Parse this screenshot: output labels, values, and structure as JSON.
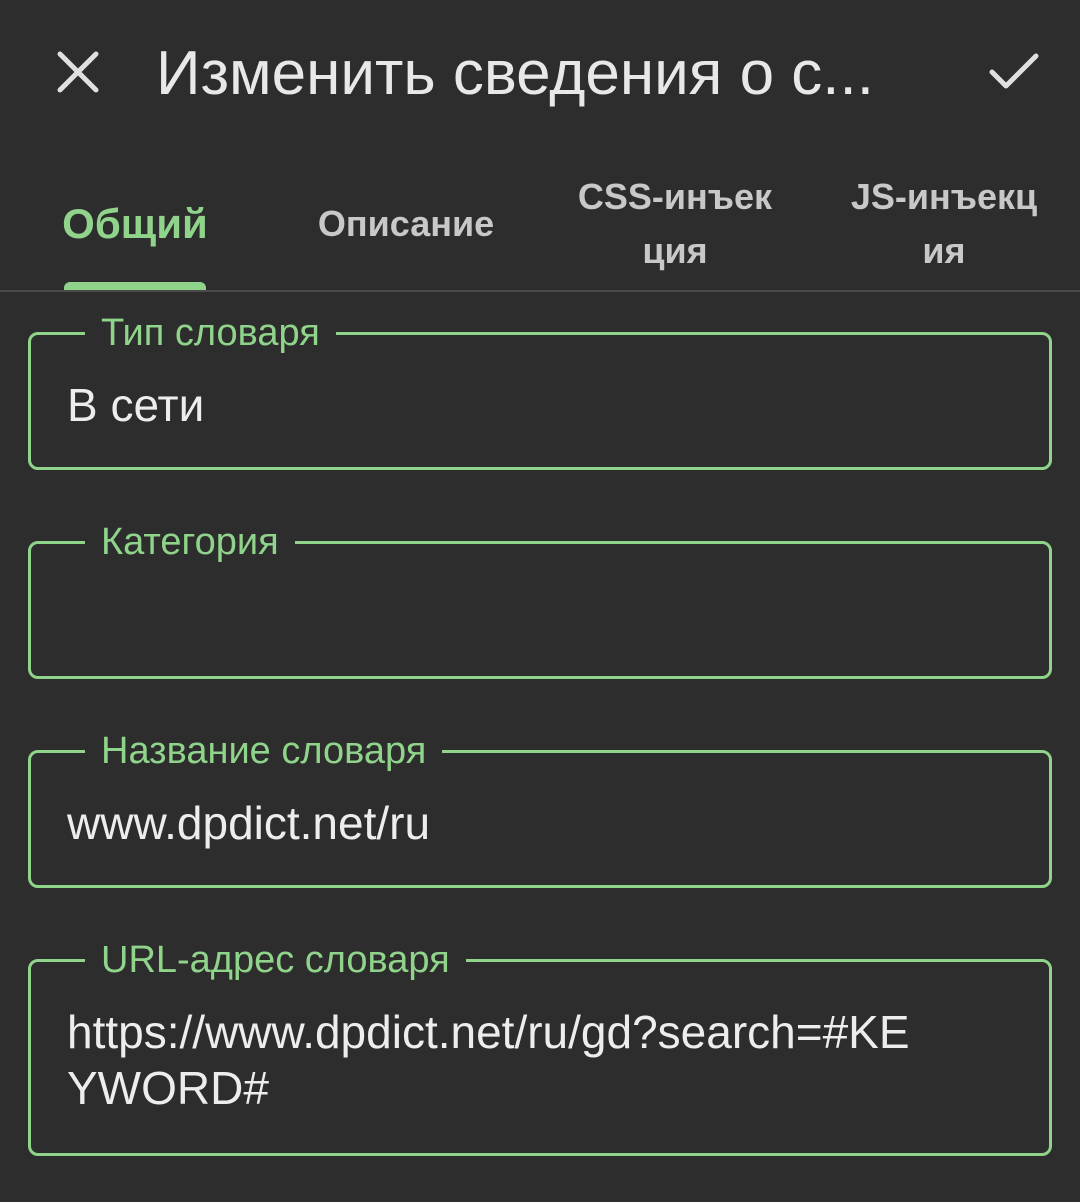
{
  "header": {
    "title": "Изменить сведения о с...",
    "close_icon": "close-icon",
    "confirm_icon": "check-icon"
  },
  "tabs": [
    {
      "label": "Общий",
      "active": true
    },
    {
      "label": "Описание",
      "active": false
    },
    {
      "label": "CSS-инъек ция",
      "active": false
    },
    {
      "label": "JS-инъекц ия",
      "active": false
    }
  ],
  "fields": {
    "dict_type": {
      "label": "Тип словаря",
      "value": "В сети"
    },
    "category": {
      "label": "Категория",
      "value": ""
    },
    "dict_name": {
      "label": "Название словаря",
      "value": "www.dpdict.net/ru"
    },
    "dict_url": {
      "label": "URL-адрес словаря",
      "value": "https://www.dpdict.net/ru/gd?search=#KEYWORD#"
    }
  },
  "colors": {
    "accent": "#8fd48a",
    "background": "#2d2d2d",
    "text": "#e8e8e8"
  }
}
